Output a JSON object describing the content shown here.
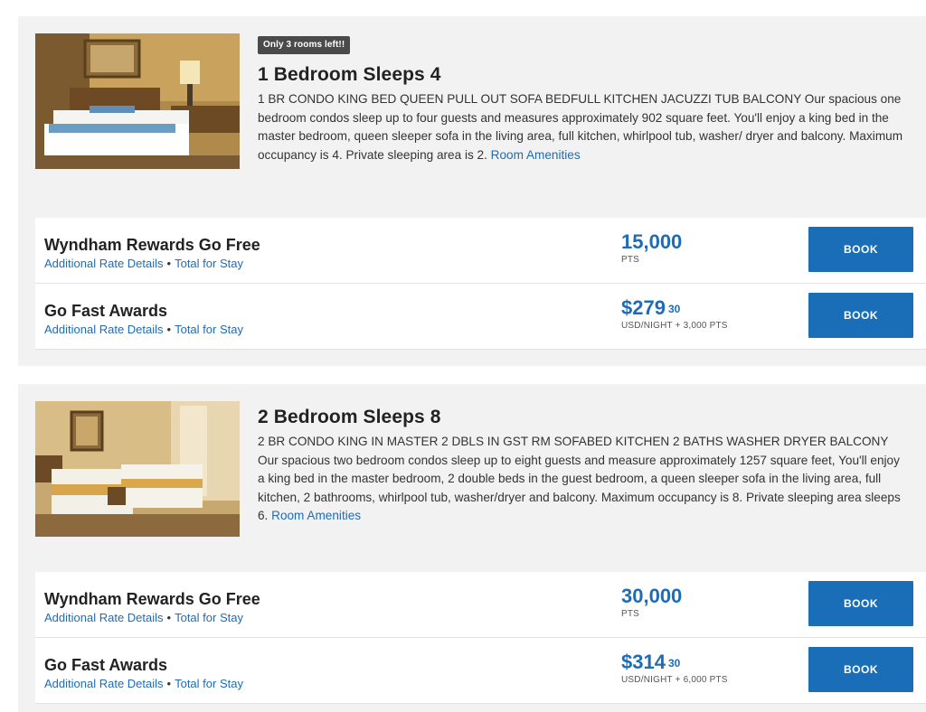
{
  "rooms": [
    {
      "badge": "Only 3 rooms left!!",
      "title": "1 Bedroom Sleeps 4",
      "description": "1 BR CONDO KING BED QUEEN PULL OUT SOFA BEDFULL KITCHEN JACUZZI TUB BALCONY Our spacious one bedroom condos sleep up to four guests and measures approximately 902 square feet. You'll enjoy a king bed in the master bedroom, queen sleeper sofa in the living area, full kitchen, whirlpool tub, washer/ dryer and balcony. Maximum occupancy is 4. Private sleeping area is 2.",
      "amenities_link": "Room Amenities",
      "rates": [
        {
          "name": "Wyndham Rewards Go Free",
          "details_link": "Additional Rate Details",
          "total_link": "Total for Stay",
          "price": "15,000",
          "cents": "",
          "unit": "PTS",
          "book_label": "BOOK"
        },
        {
          "name": "Go Fast Awards",
          "details_link": "Additional Rate Details",
          "total_link": "Total for Stay",
          "price": "$279",
          "cents": "30",
          "unit": "USD/NIGHT + 3,000 PTS",
          "book_label": "BOOK"
        }
      ]
    },
    {
      "badge": "",
      "title": "2 Bedroom Sleeps 8",
      "description": "2 BR CONDO KING IN MASTER 2 DBLS IN GST RM SOFABED KITCHEN 2 BATHS WASHER DRYER BALCONY Our spacious two bedroom condos sleep up to eight guests and measure approximately 1257 square feet, You'll enjoy a king bed in the master bedroom, 2 double beds in the guest bedroom, a queen sleeper sofa in the living area, full kitchen, 2 bathrooms, whirlpool tub, washer/dryer and balcony. Maximum occupancy is 8. Private sleeping area sleeps 6.",
      "amenities_link": "Room Amenities",
      "rates": [
        {
          "name": "Wyndham Rewards Go Free",
          "details_link": "Additional Rate Details",
          "total_link": "Total for Stay",
          "price": "30,000",
          "cents": "",
          "unit": "PTS",
          "book_label": "BOOK"
        },
        {
          "name": "Go Fast Awards",
          "details_link": "Additional Rate Details",
          "total_link": "Total for Stay",
          "price": "$314",
          "cents": "30",
          "unit": "USD/NIGHT + 6,000 PTS",
          "book_label": "BOOK"
        }
      ]
    }
  ],
  "colors": {
    "link_blue": "#1f6cb6",
    "button_blue": "#1a6eb8",
    "card_bg": "#f2f2f2",
    "badge_bg": "#4a4a4a"
  }
}
